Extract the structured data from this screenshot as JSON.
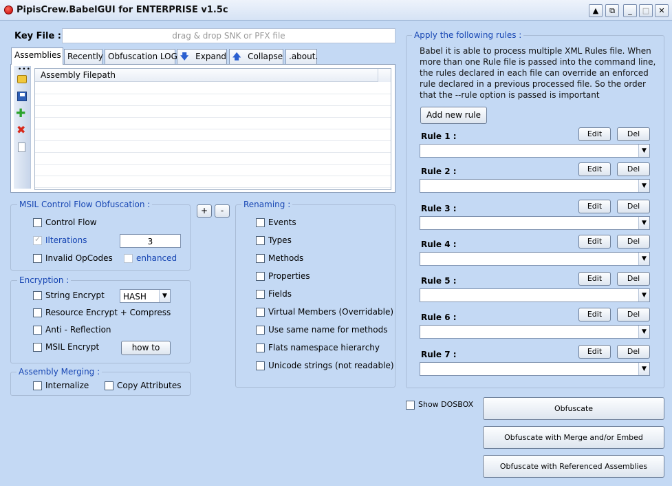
{
  "window": {
    "title": "PipisCrew.BabelGUI for ENTERPRISE v1.5c",
    "controls": [
      "▲",
      "⧉",
      "_",
      "□",
      "✕"
    ]
  },
  "keyfile": {
    "label": "Key File :",
    "placeholder": "drag & drop SNK or PFX file"
  },
  "tabs": [
    "Assemblies",
    "Recently",
    "Obfuscation LOG",
    "Expand",
    "Collapse",
    ".about."
  ],
  "assemblies": {
    "column_header": "Assembly Filepath"
  },
  "msil_group": {
    "title": "MSIL Control Flow Obfuscation :",
    "control_flow": "Control Flow",
    "iterations": "Ilterations",
    "iterations_value": "3",
    "invalid_opcodes": "Invalid OpCodes",
    "enhanced": "enhanced"
  },
  "plus_minus": {
    "plus": "+",
    "minus": "-"
  },
  "encryption": {
    "title": "Encryption :",
    "string_encrypt": "String Encrypt",
    "hash_selected": "HASH",
    "resource_encrypt": "Resource Encrypt + Compress",
    "anti_reflection": "Anti - Reflection",
    "msil_encrypt": "MSIL Encrypt",
    "how_to": "how to"
  },
  "merging": {
    "title": "Assembly Merging :",
    "internalize": "Internalize",
    "copy_attributes": "Copy Attributes"
  },
  "renaming": {
    "title": "Renaming :",
    "items": [
      "Events",
      "Types",
      "Methods",
      "Properties",
      "Fields",
      "Virtual Members (Overridable)",
      "Use same name for methods",
      "Flats namespace hierarchy",
      "Unicode strings (not readable)"
    ]
  },
  "rules": {
    "title": "Apply the following rules :",
    "description": "Babel it is able to process multiple XML Rules file. When more than one Rule file is passed into the command line, the rules declared in each file can override an enforced rule declared in a previous processed file. So the order that the --rule option is passed is important",
    "add_button": "Add new rule",
    "edit_label": "Edit",
    "del_label": "Del",
    "items": [
      "Rule 1 :",
      "Rule 2 :",
      "Rule 3 :",
      "Rule 4 :",
      "Rule 5 :",
      "Rule 6 :",
      "Rule 7 :"
    ]
  },
  "show_dosbox": "Show DOSBOX",
  "actions": {
    "obfuscate": "Obfuscate",
    "obfuscate_merge": "Obfuscate with Merge and/or Embed",
    "obfuscate_referenced": "Obfuscate with Referenced Assemblies"
  }
}
